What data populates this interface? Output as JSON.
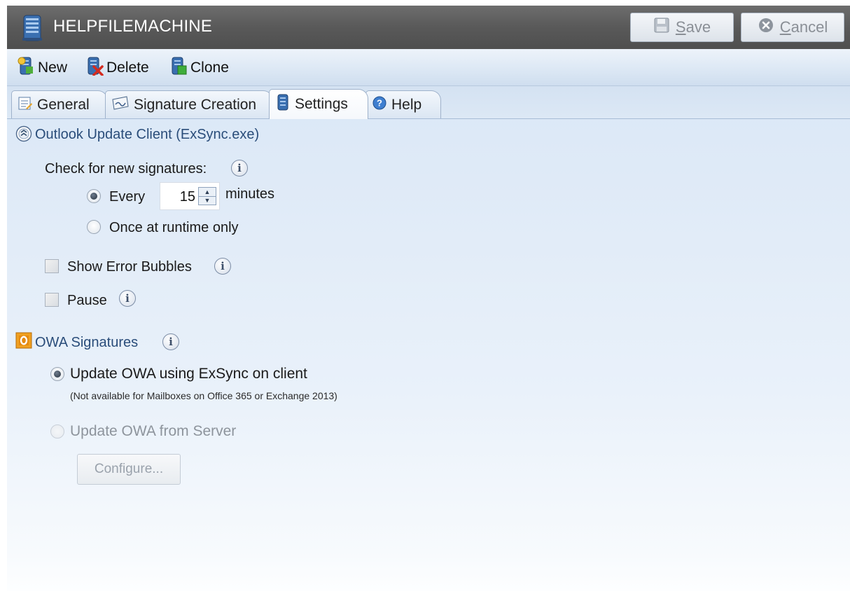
{
  "window": {
    "title": "HELPFILEMACHINE",
    "save_label": "Save",
    "cancel_label": "Cancel"
  },
  "toolbar": {
    "new_label": "New",
    "delete_label": "Delete",
    "clone_label": "Clone"
  },
  "tabs": [
    {
      "label": "General",
      "icon": "general-icon",
      "active": false
    },
    {
      "label": "Signature Creation",
      "icon": "signature-creation-icon",
      "active": false
    },
    {
      "label": "Settings",
      "icon": "settings-icon",
      "active": true
    },
    {
      "label": "Help",
      "icon": "help-icon",
      "active": false
    }
  ],
  "outlook_section": {
    "title": "Outlook Update Client (ExSync.exe)",
    "check_label": "Check for new signatures:",
    "every_label": "Every",
    "every_selected": true,
    "minutes_value": "15",
    "minutes_label": "minutes",
    "once_label": "Once at runtime only",
    "once_selected": false,
    "show_error_bubbles_label": "Show Error Bubbles",
    "show_error_bubbles_checked": false,
    "pause_label": "Pause",
    "pause_checked": false
  },
  "owa_section": {
    "title": "OWA Signatures",
    "exsync_label": "Update OWA using ExSync on client",
    "exsync_selected": true,
    "exsync_note": "(Not available for Mailboxes on Office 365 or Exchange 2013)",
    "server_label": "Update OWA from Server",
    "server_selected": false,
    "server_enabled": false,
    "configure_label": "Configure..."
  },
  "colors": {
    "title_bar": "#595959",
    "content_background": "#dfeaf7",
    "owa_icon": "#f0a020"
  }
}
